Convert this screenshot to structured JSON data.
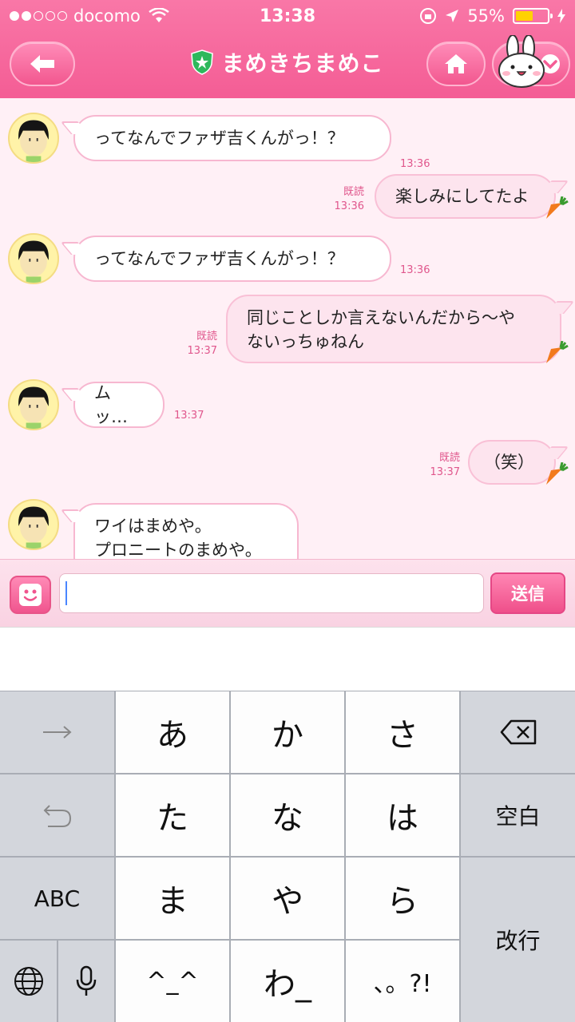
{
  "status_bar": {
    "carrier": "docomo",
    "time": "13:38",
    "battery": "55%",
    "battery_color": "#ffd200",
    "signal_icon": "signal-dots-icon",
    "wifi_icon": "wifi-icon"
  },
  "header": {
    "title": "まめきちまめこ",
    "back_icon": "back-arrow-icon",
    "home_icon": "home-icon",
    "menu_icon": "chevron-down-icon",
    "brand_color": "#f45d95"
  },
  "messages": [
    {
      "side": "in",
      "text": "ってなんでファザ吉くんがっ！？",
      "time": "13:36"
    },
    {
      "side": "out",
      "text": "楽しみにしてたよ",
      "read": "既読",
      "time": "13:36"
    },
    {
      "side": "in",
      "text": "ってなんでファザ吉くんがっ！？",
      "time": "13:36"
    },
    {
      "side": "out",
      "line1": "同じことしか言えないんだから〜や",
      "line2": "ないっちゅねん",
      "read": "既読",
      "time": "13:37"
    },
    {
      "side": "in",
      "text": "ムッ…",
      "time": "13:37"
    },
    {
      "side": "out",
      "text": "（笑）",
      "read": "既読",
      "time": "13:37"
    },
    {
      "side": "in",
      "line1": "ワイはまめや。",
      "line2": "プロニートのまめや。"
    }
  ],
  "input_bar": {
    "value": "",
    "send_label": "送信",
    "emoji_icon": "smiley-icon"
  },
  "keyboard": {
    "row1": {
      "left_icon": "arrow-right-icon",
      "keys": [
        "あ",
        "か",
        "さ"
      ],
      "right_icon": "backspace-icon"
    },
    "row2": {
      "left_icon": "undo-icon",
      "keys": [
        "た",
        "な",
        "は"
      ],
      "right": "空白"
    },
    "row3": {
      "left": "ABC",
      "keys": [
        "ま",
        "や",
        "ら"
      ],
      "right": "改行"
    },
    "row4": {
      "globe_icon": "globe-icon",
      "mic_icon": "microphone-icon",
      "keys": [
        "^_^",
        "わ_",
        "、。?!"
      ]
    }
  }
}
